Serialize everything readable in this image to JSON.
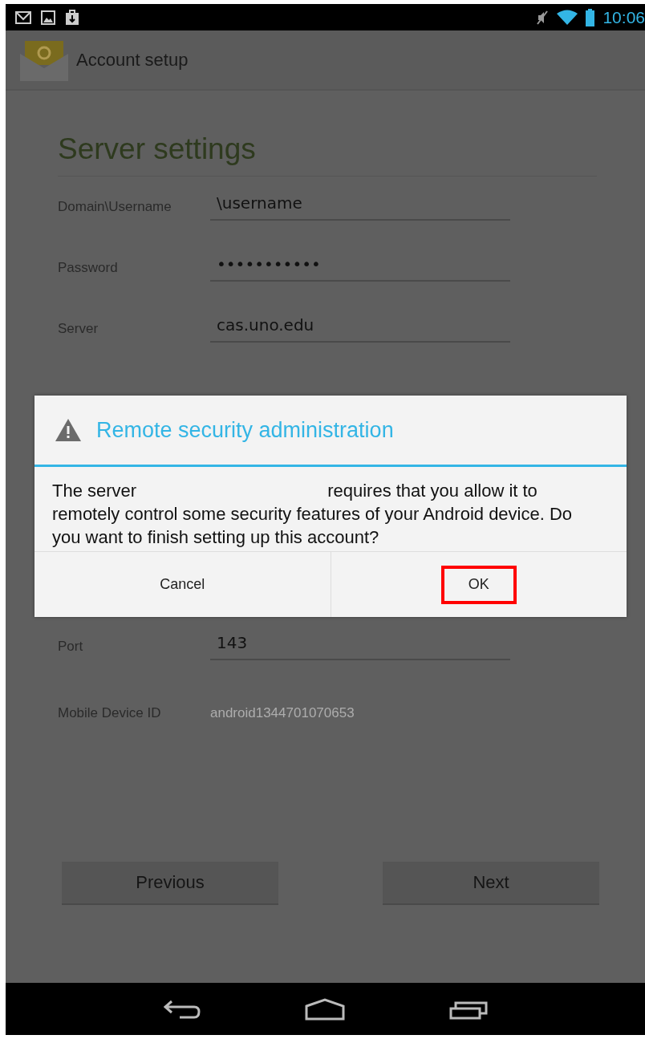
{
  "status_bar": {
    "time": "10:06"
  },
  "action_bar": {
    "title": "Account setup"
  },
  "page": {
    "title": "Server settings"
  },
  "fields": [
    {
      "label": "Domain\\Username",
      "value": "\\username",
      "kind": "input"
    },
    {
      "label": "Password",
      "value": "•••••••••••",
      "kind": "input"
    },
    {
      "label": "Server",
      "value": "cas.uno.edu",
      "kind": "input"
    }
  ],
  "lower_fields": [
    {
      "label": "Port",
      "value": "143",
      "kind": "input"
    },
    {
      "label": "Mobile Device ID",
      "value": "android1344701070653",
      "kind": "static"
    }
  ],
  "buttons": [
    {
      "label": "Previous"
    },
    {
      "label": "Next"
    }
  ],
  "dialog": {
    "title": "Remote security administration",
    "message_start": "The server",
    "message_end": "requires that you allow it to remotely control some security features of your Android device. Do you want to finish setting up this account?",
    "buttons": [
      {
        "label": "Cancel",
        "highlighted": false
      },
      {
        "label": "OK",
        "highlighted": true
      }
    ]
  }
}
